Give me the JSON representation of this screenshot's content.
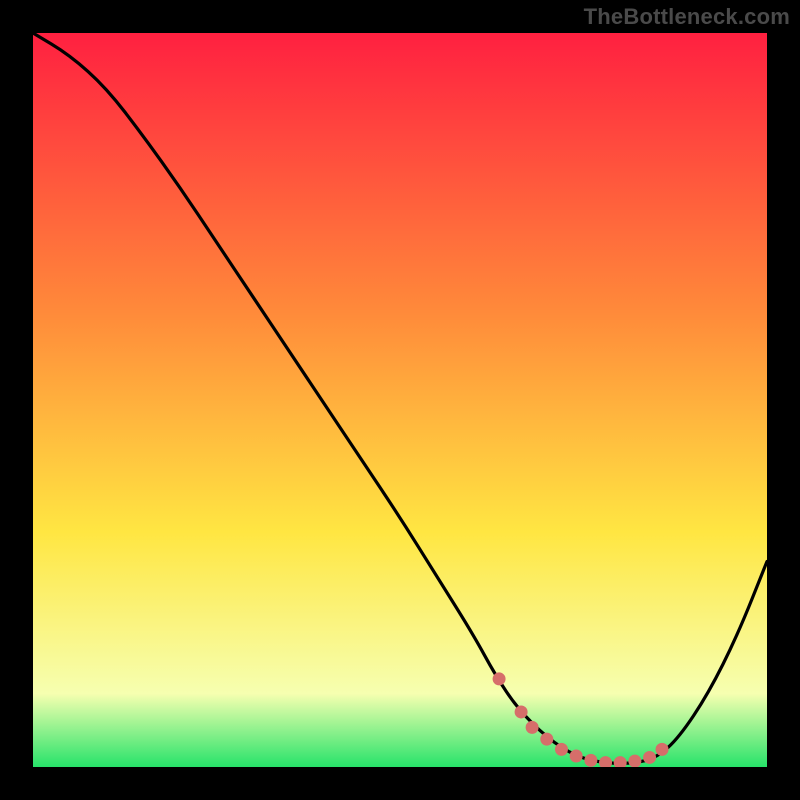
{
  "attribution": "TheBottleneck.com",
  "colors": {
    "frame": "#000000",
    "grad_top": "#ff2040",
    "grad_mid1": "#ff8a3a",
    "grad_mid2": "#ffe642",
    "grad_mid3": "#f6ffb0",
    "grad_bottom": "#27e36a",
    "curve_stroke": "#000000",
    "dot_fill": "#d66e6a",
    "attribution_text": "#4a4a4a"
  },
  "chart_data": {
    "type": "line",
    "title": "",
    "xlabel": "",
    "ylabel": "",
    "xlim": [
      0,
      100
    ],
    "ylim": [
      0,
      100
    ],
    "grid": false,
    "series": [
      {
        "name": "curve",
        "x": [
          0,
          5,
          10,
          15,
          20,
          25,
          30,
          35,
          40,
          45,
          50,
          55,
          60,
          63,
          66,
          70,
          74,
          78,
          82,
          85,
          88,
          92,
          96,
          100
        ],
        "y": [
          100,
          97,
          92.5,
          86,
          79,
          71.5,
          64,
          56.5,
          49,
          41.5,
          34,
          26,
          18,
          12.5,
          8,
          4,
          1.4,
          0.5,
          0.5,
          1.3,
          4,
          10,
          18,
          28
        ]
      }
    ],
    "annotations": {
      "flat_region_dots": {
        "x": [
          63.5,
          66.5,
          68,
          70,
          72,
          74,
          76,
          78,
          80,
          82,
          84,
          85.7
        ],
        "y": [
          12.0,
          7.5,
          5.4,
          3.8,
          2.4,
          1.5,
          0.9,
          0.6,
          0.6,
          0.8,
          1.3,
          2.4
        ]
      }
    }
  }
}
